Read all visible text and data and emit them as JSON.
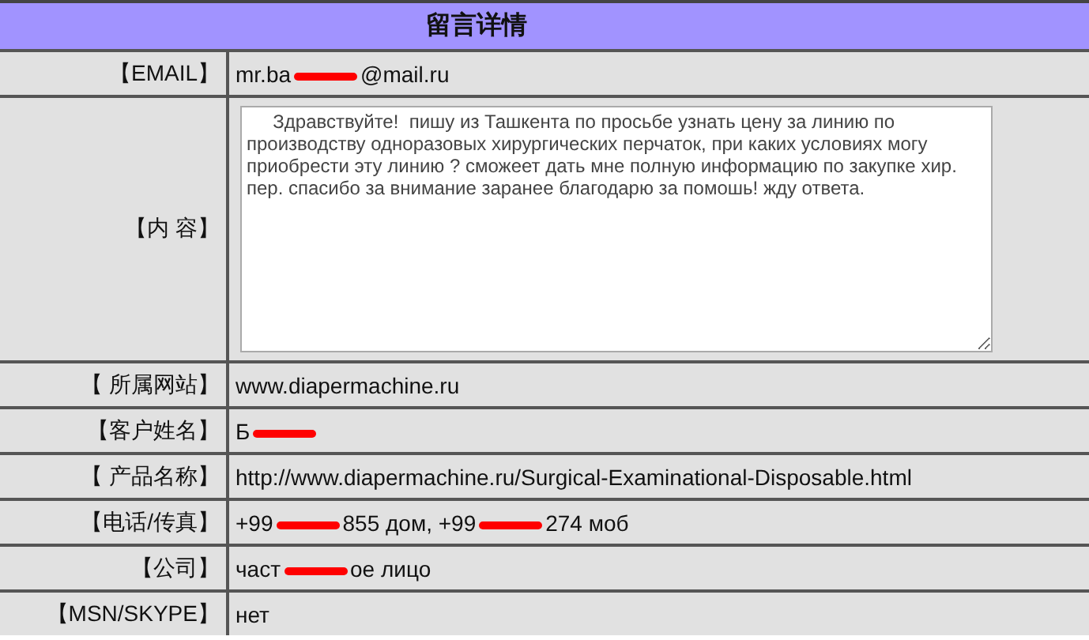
{
  "title": "留言详情",
  "rows": [
    {
      "label": "【EMAIL】",
      "kind": "text",
      "parts": [
        {
          "kind": "text",
          "text": "mr.ba"
        },
        {
          "kind": "redaction"
        },
        {
          "kind": "text",
          "text": "@mail.ru"
        }
      ]
    },
    {
      "label": "【内 容】",
      "kind": "textarea",
      "value": "     Здравствуйте!  пишу из Ташкента по просьбе узнать цену за линию по производству одноразовых хирургических перчаток, при каких условиях могу приобрести эту линию ? сможеет дать мне полную информацию по закупке хир. пер. спасибо за внимание заранее благодарю за помошь! жду ответа."
    },
    {
      "label": "【 所属网站】",
      "kind": "text",
      "parts": [
        {
          "kind": "text",
          "text": "www.diapermachine.ru"
        }
      ]
    },
    {
      "label": "【客户姓名】",
      "kind": "text",
      "parts": [
        {
          "kind": "text",
          "text": "Б"
        },
        {
          "kind": "redaction"
        }
      ]
    },
    {
      "label": "【 产品名称】",
      "kind": "text",
      "parts": [
        {
          "kind": "text",
          "text": "http://www.diapermachine.ru/Surgical-Examinational-Disposable.html"
        }
      ]
    },
    {
      "label": "【电话/传真】",
      "kind": "text",
      "parts": [
        {
          "kind": "text",
          "text": "+99"
        },
        {
          "kind": "redaction"
        },
        {
          "kind": "text",
          "text": "855 дом, +99"
        },
        {
          "kind": "redaction"
        },
        {
          "kind": "text",
          "text": "274 моб"
        }
      ]
    },
    {
      "label": "【公司】",
      "kind": "text",
      "parts": [
        {
          "kind": "text",
          "text": "част"
        },
        {
          "kind": "redaction"
        },
        {
          "kind": "text",
          "text": "ое лицо"
        }
      ]
    },
    {
      "label": "【MSN/SKYPE】",
      "kind": "text",
      "parts": [
        {
          "kind": "text",
          "text": "нет"
        }
      ]
    }
  ]
}
